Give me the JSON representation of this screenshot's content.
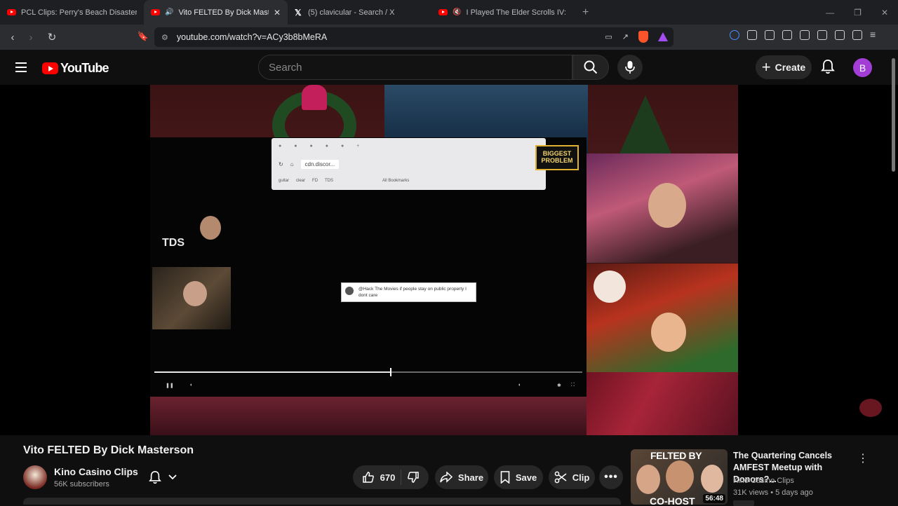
{
  "browser": {
    "tabs": [
      {
        "title": "PCL Clips: Perry's Beach Disaster - Yo",
        "favicon": "youtube-icon",
        "active": false
      },
      {
        "title": "Vito FELTED By Dick Masterso",
        "favicon": "youtube-icon",
        "active": true
      },
      {
        "title": "(5) clavicular - Search / X",
        "favicon": "x-icon",
        "active": false
      },
      {
        "title": "I Played The Elder Scrolls IV: Obl",
        "favicon": "youtube-icon",
        "active": false
      }
    ],
    "url": "youtube.com/watch?v=ACy3b8bMeRA"
  },
  "youtube": {
    "logo_text": "YouTube",
    "search_placeholder": "Search",
    "create_label": "Create",
    "avatar_letter": "B"
  },
  "video_content": {
    "biggest_problem_line1": "BIGGEST",
    "biggest_problem_line2": "PROBLEM",
    "cam_overlay_text": "TDS",
    "mini_url": "cdn.discor...",
    "mini_bookmarks": [
      "guitar",
      "clear",
      "FD",
      "TDS",
      "All Bookmarks"
    ],
    "chat_popup": "@Hack The Movies if people stay on public property I dont care",
    "progress_fraction": 0.55
  },
  "video": {
    "title": "Vito FELTED By Dick Masterson",
    "channel_name": "Kino Casino Clips",
    "subscribers": "56K subscribers",
    "likes": "670",
    "share_label": "Share",
    "save_label": "Save",
    "clip_label": "Clip"
  },
  "recommendation": {
    "thumb_top_text": "FELTED BY",
    "thumb_bottom_text": "CO-HOST",
    "duration": "56:48",
    "title": "The Quartering Cancels AMFEST Meetup with Donors?...",
    "channel": "Kino Casino Clips",
    "meta": "31K views • 5 days ago"
  },
  "colors": {
    "youtube_red": "#ff0000",
    "avatar_purple": "#a23dd6",
    "background": "#0f0f0f"
  }
}
